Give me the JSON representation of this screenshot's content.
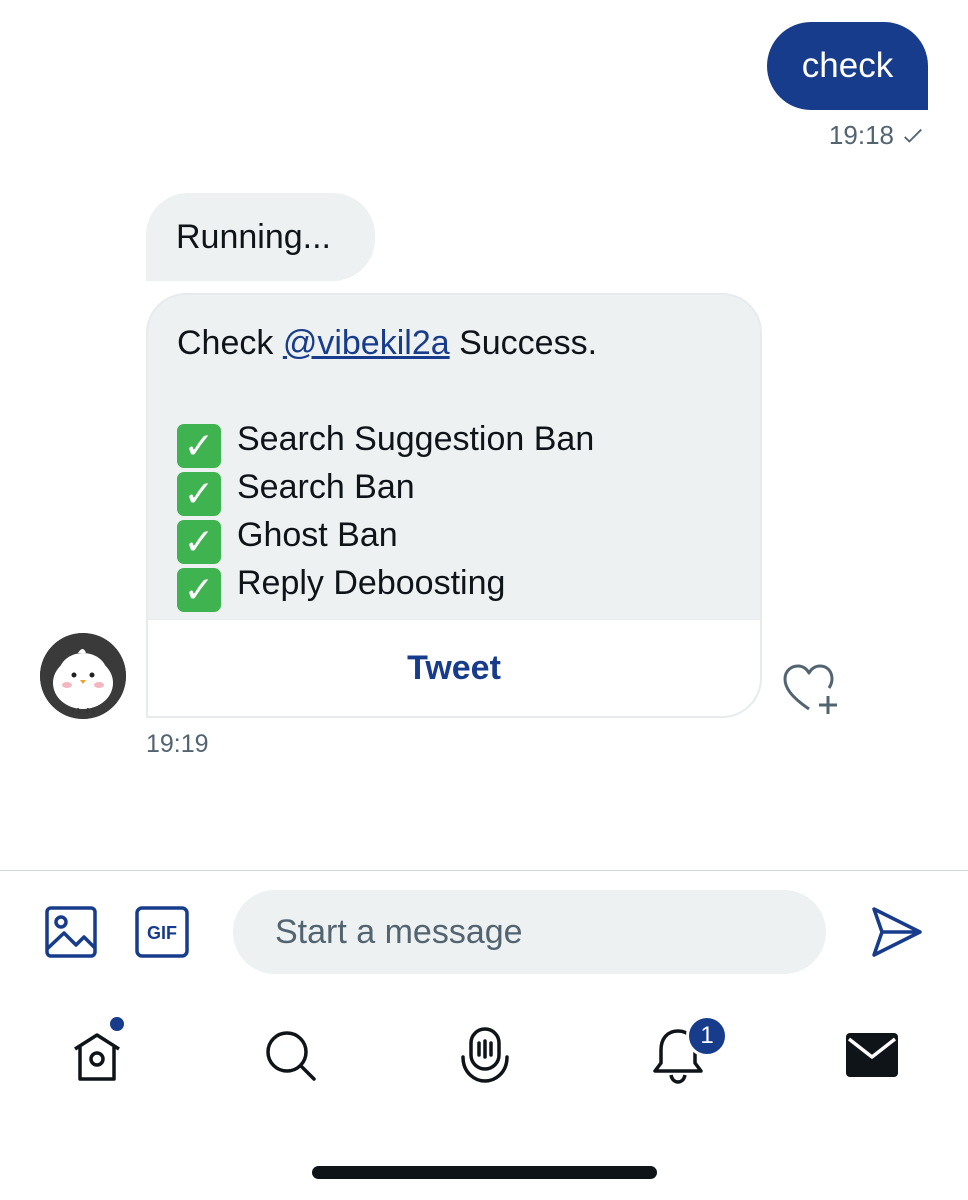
{
  "conversation": {
    "sent": {
      "text": "check",
      "time": "19:18"
    },
    "received": {
      "status_text": "Running...",
      "card": {
        "prefix": "Check ",
        "mention": "@vibekil2a",
        "suffix": " Success.",
        "results": [
          "Search Suggestion Ban",
          "Search Ban",
          "Ghost Ban",
          "Reply Deboosting"
        ],
        "check_icon": "white-check-mark-icon",
        "button_label": "Tweet"
      },
      "time": "19:19",
      "avatar_icon": "chick-avatar"
    }
  },
  "composer": {
    "placeholder": "Start a message",
    "gif_label": "GIF"
  },
  "tab_bar": {
    "notifications_badge": "1"
  },
  "colors": {
    "accent": "#183c8c",
    "bubble_bg": "#eef1f2",
    "check_green": "#3fb34f"
  }
}
